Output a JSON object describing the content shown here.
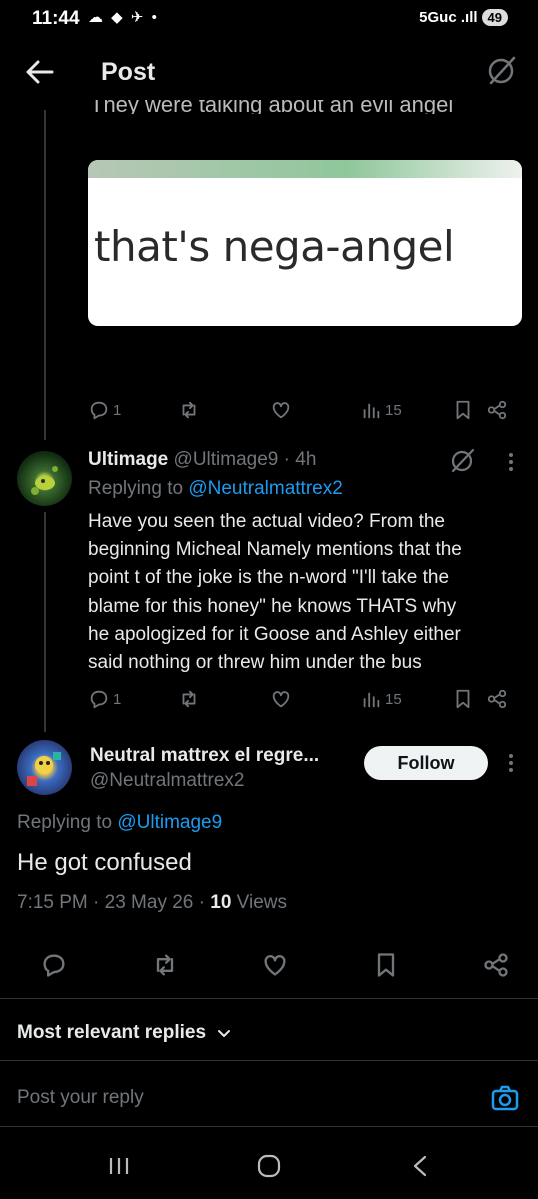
{
  "status_bar": {
    "time": "11:44",
    "icons": "☁ ◆ ✈ •",
    "network": "5Guc .ıll",
    "battery": "49"
  },
  "header": {
    "title": "Post"
  },
  "quoted_image": {
    "cut_caption": "They were talking about an evil angel",
    "text": "that's nega-angel"
  },
  "reply1_actions": {
    "reply_count": "1",
    "views": "15"
  },
  "reply2": {
    "name": "Ultimage",
    "handle": "@Ultimage9",
    "time": "· 4h",
    "replying_prefix": "Replying to",
    "replying_handle": "@Neutralmattrex2",
    "lines": [
      "Have you seen the actual video? From the",
      "beginning Micheal Namely mentions that the",
      "point t of the joke is the n-word \"I'll take the",
      "blame for this honey\" he knows THATS why",
      "he apologized for it Goose and Ashley either",
      "said nothing or threw him under the bus"
    ],
    "reply_count": "1",
    "views": "15"
  },
  "main_post": {
    "name": "Neutral mattrex el regre...",
    "handle": "@Neutralmattrex2",
    "follow_label": "Follow",
    "replying_prefix": "Replying to",
    "replying_handle": "@Ultimage9",
    "text": "He got confused",
    "timestamp": "7:15 PM · 23 May 26 ·",
    "views_count": "10",
    "views_label": "Views"
  },
  "replies_sort": {
    "label": "Most relevant replies"
  },
  "composer": {
    "placeholder": "Post your reply"
  },
  "colors": {
    "accent": "#1d9bf0",
    "background": "#000000",
    "muted": "#71767b"
  }
}
